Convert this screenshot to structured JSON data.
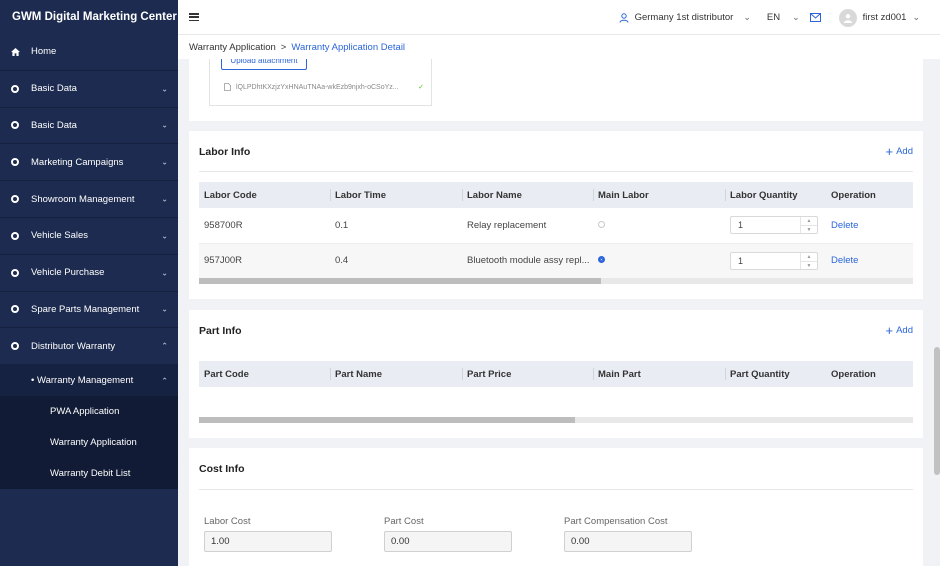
{
  "app": {
    "title": "GWM Digital Marketing Center"
  },
  "sidebar": {
    "items": [
      {
        "label": "Home",
        "icon": "home-icon"
      },
      {
        "label": "Basic Data",
        "icon": "circle-icon",
        "chevron": "⌄"
      },
      {
        "label": "Basic Data",
        "icon": "circle-icon",
        "chevron": "⌄"
      },
      {
        "label": "Marketing Campaigns",
        "icon": "circle-icon",
        "chevron": "⌄"
      },
      {
        "label": "Showroom Management",
        "icon": "circle-icon",
        "chevron": "⌄"
      },
      {
        "label": "Vehicle Sales",
        "icon": "circle-icon",
        "chevron": "⌄"
      },
      {
        "label": "Vehicle Purchase",
        "icon": "circle-icon",
        "chevron": "⌄"
      },
      {
        "label": "Spare Parts Management",
        "icon": "circle-icon",
        "chevron": "⌄"
      },
      {
        "label": "Distributor Warranty",
        "icon": "circle-icon",
        "chevron": "⌃"
      }
    ],
    "submenu": {
      "label": "• Warranty Management",
      "chevron": "⌃",
      "children": [
        "PWA Application",
        "Warranty Application",
        "Warranty Debit List"
      ]
    }
  },
  "topbar": {
    "distributor": "Germany 1st distributor",
    "language": "EN",
    "user": "first zd001"
  },
  "breadcrumb": {
    "parent": "Warranty Application",
    "separator": ">",
    "current": "Warranty Application Detail"
  },
  "attachment": {
    "upload_label": "Upload attachment",
    "file_name": "lQLPDhtKXzjzYxHNAuTNAa-wkEzb9njxh-oCSoYz..."
  },
  "labor": {
    "title": "Labor Info",
    "add_label": "Add",
    "columns": [
      "Labor Code",
      "Labor Time",
      "Labor Name",
      "Main Labor",
      "Labor Quantity",
      "Operation"
    ],
    "rows": [
      {
        "code": "958700R",
        "time": "0.1",
        "name": "Relay replacement",
        "main": false,
        "quantity": "1",
        "op": "Delete"
      },
      {
        "code": "957J00R",
        "time": "0.4",
        "name": "Bluetooth module assy repl...",
        "main": true,
        "quantity": "1",
        "op": "Delete"
      }
    ]
  },
  "part": {
    "title": "Part Info",
    "add_label": "Add",
    "columns": [
      "Part Code",
      "Part Name",
      "Part Price",
      "Main Part",
      "Part Quantity",
      "Operation"
    ]
  },
  "cost": {
    "title": "Cost Info",
    "fields": [
      {
        "label": "Labor Cost",
        "value": "1.00"
      },
      {
        "label": "Part Cost",
        "value": "0.00"
      },
      {
        "label": "Part Compensation Cost",
        "value": "0.00"
      }
    ]
  },
  "colors": {
    "sidebar_bg": "#1c2b4f",
    "accent": "#2b65d9",
    "header_row": "#e9ecf3"
  }
}
